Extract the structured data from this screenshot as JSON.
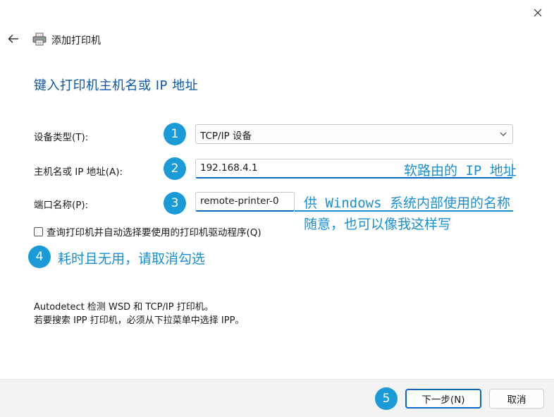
{
  "window": {
    "title": "添加打印机"
  },
  "heading": "键入打印机主机名或 IP 地址",
  "fields": {
    "device_type": {
      "label": "设备类型(T):",
      "value": "TCP/IP 设备"
    },
    "hostname": {
      "label": "主机名或 IP 地址(A):",
      "value": "192.168.4.1"
    },
    "port_name": {
      "label": "端口名称(P):",
      "value": "remote-printer-0"
    }
  },
  "checkbox": {
    "label": "查询打印机并自动选择要使用的打印机驱动程序(Q)",
    "checked": false
  },
  "description": {
    "line1": "Autodetect 检测 WSD 和 TCP/IP 打印机。",
    "line2": "若要搜索 IPP 打印机，必须从下拉菜单中选择 IPP。"
  },
  "annotations": {
    "badge1": "1",
    "badge2": "2",
    "badge3": "3",
    "badge4": "4",
    "badge5": "5",
    "note2": "软路由的 IP 地址",
    "note3_line1": "供 Windows 系统内部使用的名称",
    "note3_line2": "随意，也可以像我这样写",
    "note4": "耗时且无用，请取消勾选"
  },
  "buttons": {
    "next": "下一步(N)",
    "cancel": "取消"
  },
  "colors": {
    "accent": "#0b67c2",
    "annotation": "#1a9bd7",
    "heading": "#0b57a8"
  }
}
